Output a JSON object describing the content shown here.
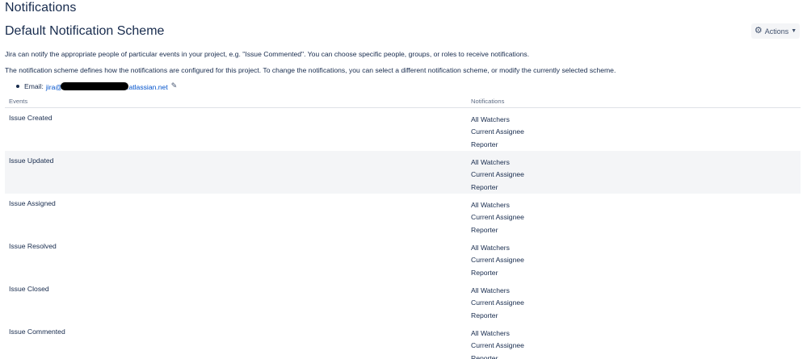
{
  "page": {
    "title": "Notifications",
    "scheme_title": "Default Notification Scheme"
  },
  "toolbar": {
    "actions_label": "Actions",
    "actions_icon": "gear-icon",
    "actions_chevron": "chevron-down-icon"
  },
  "description": {
    "line1": "Jira can notify the appropriate people of particular events in your project, e.g. \"Issue Commented\". You can choose specific people, groups, or roles to receive notifications.",
    "line2": "The notification scheme defines how the notifications are configured for this project. To change the notifications, you can select a different notification scheme, or modify the currently selected scheme."
  },
  "email": {
    "label": "Email:",
    "prefix": "jira@",
    "suffix": ".atlassian.net",
    "edit_icon": "pencil-icon"
  },
  "table": {
    "headers": {
      "events": "Events",
      "notifications": "Notifications"
    },
    "rows": [
      {
        "event": "Issue Created",
        "notifications": [
          "All Watchers",
          "Current Assignee",
          "Reporter"
        ]
      },
      {
        "event": "Issue Updated",
        "notifications": [
          "All Watchers",
          "Current Assignee",
          "Reporter"
        ]
      },
      {
        "event": "Issue Assigned",
        "notifications": [
          "All Watchers",
          "Current Assignee",
          "Reporter"
        ]
      },
      {
        "event": "Issue Resolved",
        "notifications": [
          "All Watchers",
          "Current Assignee",
          "Reporter"
        ]
      },
      {
        "event": "Issue Closed",
        "notifications": [
          "All Watchers",
          "Current Assignee",
          "Reporter"
        ]
      },
      {
        "event": "Issue Commented",
        "notifications": [
          "All Watchers",
          "Current Assignee",
          "Reporter"
        ]
      }
    ]
  },
  "colors": {
    "text": "#172b4d",
    "link": "#0052cc",
    "row_alt_bg": "#f4f5f7",
    "header_text": "#5e6c84",
    "border": "#dfe1e6"
  }
}
